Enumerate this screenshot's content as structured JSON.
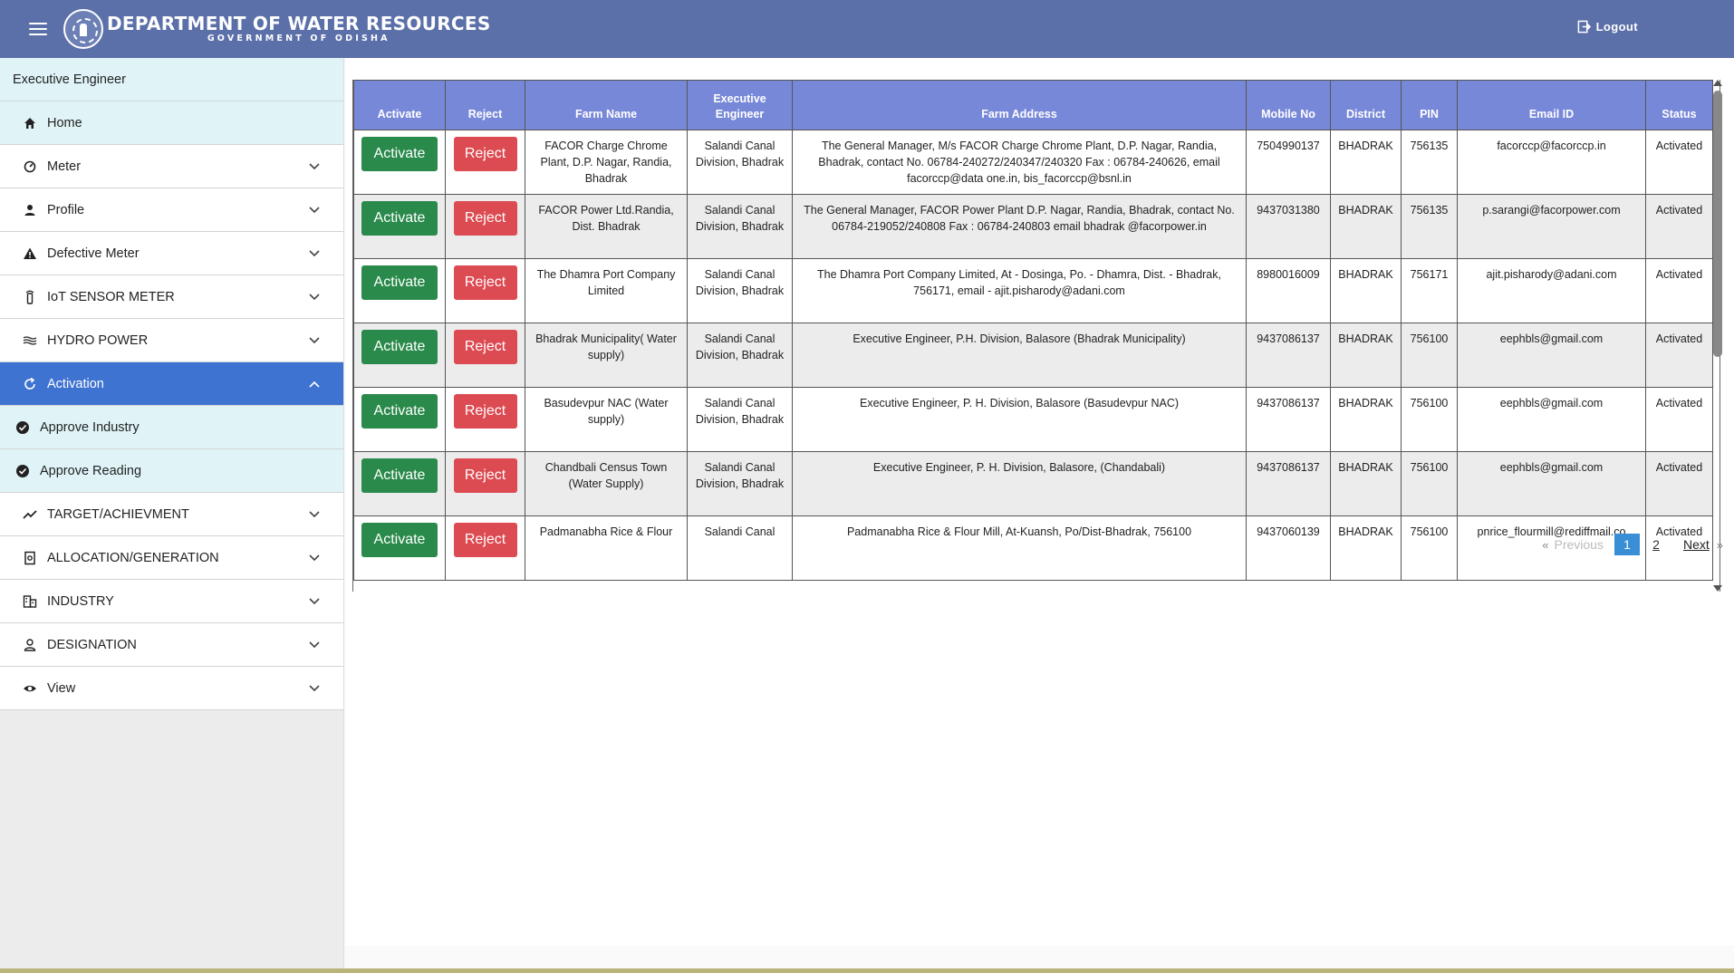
{
  "header": {
    "title": "DEPARTMENT OF WATER RESOURCES",
    "subtitle": "GOVERNMENT OF ODISHA",
    "logout_label": "Logout"
  },
  "sidebar": {
    "role": "Executive Engineer",
    "items": [
      {
        "label": "Home"
      },
      {
        "label": "Meter"
      },
      {
        "label": "Profile"
      },
      {
        "label": "Defective Meter"
      },
      {
        "label": "IoT SENSOR METER"
      },
      {
        "label": "HYDRO POWER"
      },
      {
        "label": "Activation"
      },
      {
        "label": "Approve Industry"
      },
      {
        "label": "Approve Reading"
      },
      {
        "label": "TARGET/ACHIEVMENT"
      },
      {
        "label": "ALLOCATION/GENERATION"
      },
      {
        "label": "INDUSTRY"
      },
      {
        "label": "DESIGNATION"
      },
      {
        "label": "View"
      }
    ]
  },
  "table": {
    "headers": [
      "Activate",
      "Reject",
      "Farm Name",
      "Executive Engineer",
      "Farm Address",
      "Mobile No",
      "District",
      "PIN",
      "Email ID",
      "Status"
    ],
    "activate_label": "Activate",
    "reject_label": "Reject",
    "rows": [
      {
        "farm": "FACOR Charge Chrome Plant, D.P. Nagar, Randia, Bhadrak",
        "engineer": "Salandi Canal Division, Bhadrak",
        "address": "The General Manager, M/s FACOR Charge Chrome Plant, D.P. Nagar, Randia, Bhadrak, contact No. 06784-240272/240347/240320 Fax : 06784-240626, email facorccp@data one.in, bis_facorccp@bsnl.in",
        "mobile": "7504990137",
        "district": "BHADRAK",
        "pin": "756135",
        "email": "facorccp@facorccp.in",
        "status": "Activated"
      },
      {
        "farm": "FACOR Power Ltd.Randia, Dist. Bhadrak",
        "engineer": "Salandi Canal Division, Bhadrak",
        "address": "The General Manager, FACOR Power Plant D.P. Nagar, Randia, Bhadrak, contact No. 06784-219052/240808 Fax : 06784-240803 email bhadrak @facorpower.in",
        "mobile": "9437031380",
        "district": "BHADRAK",
        "pin": "756135",
        "email": "p.sarangi@facorpower.com",
        "status": "Activated"
      },
      {
        "farm": "The Dhamra Port Company Limited",
        "engineer": "Salandi Canal Division, Bhadrak",
        "address": "The Dhamra Port Company Limited, At - Dosinga, Po. - Dhamra, Dist. - Bhadrak, 756171, email - ajit.pisharody@adani.com",
        "mobile": "8980016009",
        "district": "BHADRAK",
        "pin": "756171",
        "email": "ajit.pisharody@adani.com",
        "status": "Activated"
      },
      {
        "farm": "Bhadrak Municipality( Water supply)",
        "engineer": "Salandi Canal Division, Bhadrak",
        "address": "Executive Engineer, P.H. Division, Balasore (Bhadrak Municipality)",
        "mobile": "9437086137",
        "district": "BHADRAK",
        "pin": "756100",
        "email": "eephbls@gmail.com",
        "status": "Activated"
      },
      {
        "farm": "Basudevpur NAC (Water supply)",
        "engineer": "Salandi Canal Division, Bhadrak",
        "address": "Executive Engineer, P. H. Division, Balasore (Basudevpur NAC)",
        "mobile": "9437086137",
        "district": "BHADRAK",
        "pin": "756100",
        "email": "eephbls@gmail.com",
        "status": "Activated"
      },
      {
        "farm": "Chandbali Census Town (Water Supply)",
        "engineer": "Salandi Canal Division, Bhadrak",
        "address": "Executive Engineer, P. H. Division, Balasore, (Chandabali)",
        "mobile": "9437086137",
        "district": "BHADRAK",
        "pin": "756100",
        "email": "eephbls@gmail.com",
        "status": "Activated"
      },
      {
        "farm": "Padmanabha Rice & Flour",
        "engineer": "Salandi Canal",
        "address": "Padmanabha Rice & Flour Mill, At-Kuansh, Po/Dist-Bhadrak, 756100",
        "mobile": "9437060139",
        "district": "BHADRAK",
        "pin": "756100",
        "email": "pnrice_flourmill@rediffmail.co",
        "status": "Activated"
      }
    ]
  },
  "pagination": {
    "prev_label": "Previous",
    "next_label": "Next",
    "pages": [
      "1",
      "2"
    ],
    "current": "1",
    "left_quote": "«",
    "right_quote": "»"
  },
  "colors": {
    "header_bg": "#5b6fa8",
    "active_nav": "#3f73d1",
    "table_header": "#7888d8",
    "activate_button": "#2a8a4b",
    "reject_button": "#dc4a52",
    "current_page": "#3a8ed6"
  },
  "icons": {
    "menu": "hamburger-icon",
    "logout": "logout-icon",
    "home": "home-icon",
    "meter": "gauge-icon",
    "profile": "person-icon",
    "defective": "warning-icon",
    "iot": "sensor-icon",
    "hydro": "waves-icon",
    "activation": "refresh-icon",
    "approve": "check-circle-icon",
    "target": "trending-up-icon",
    "allocation": "document-search-icon",
    "industry": "building-icon",
    "designation": "person-outline-icon",
    "view": "eye-icon",
    "chevron": "chevron-icon"
  }
}
